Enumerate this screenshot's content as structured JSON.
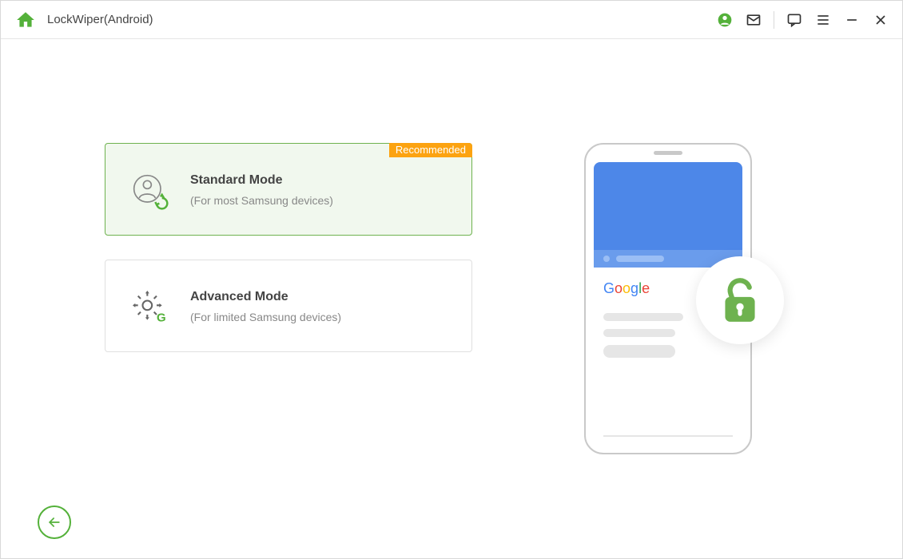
{
  "titlebar": {
    "app_title": "LockWiper(Android)"
  },
  "modes": {
    "standard": {
      "badge": "Recommended",
      "title": "Standard Mode",
      "subtitle": "(For most Samsung devices)"
    },
    "advanced": {
      "title": "Advanced Mode",
      "subtitle": "(For limited Samsung devices)"
    }
  },
  "illustration": {
    "google_text": "Google"
  },
  "colors": {
    "accent_green": "#54b13a",
    "badge_orange": "#fca311",
    "phone_blue": "#4d87e8"
  }
}
